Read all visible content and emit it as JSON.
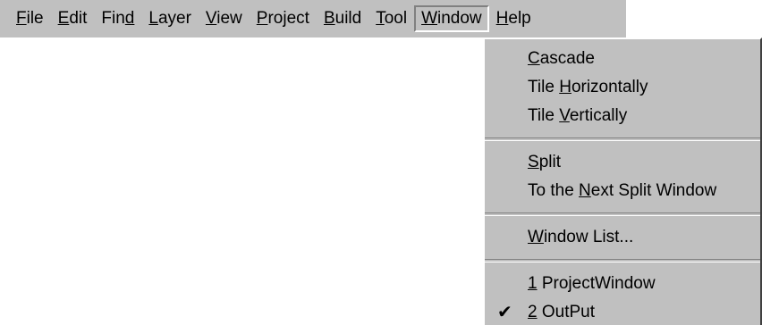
{
  "menubar": {
    "items": [
      {
        "pre": "",
        "ul": "F",
        "post": "ile"
      },
      {
        "pre": "",
        "ul": "E",
        "post": "dit"
      },
      {
        "pre": "Fin",
        "ul": "d",
        "post": ""
      },
      {
        "pre": "",
        "ul": "L",
        "post": "ayer"
      },
      {
        "pre": "",
        "ul": "V",
        "post": "iew"
      },
      {
        "pre": "",
        "ul": "P",
        "post": "roject"
      },
      {
        "pre": "",
        "ul": "B",
        "post": "uild"
      },
      {
        "pre": "",
        "ul": "T",
        "post": "ool"
      },
      {
        "pre": "",
        "ul": "W",
        "post": "indow"
      },
      {
        "pre": "",
        "ul": "H",
        "post": "elp"
      }
    ]
  },
  "window_menu": {
    "cascade": {
      "pre": "",
      "ul": "C",
      "post": "ascade"
    },
    "tile_h": {
      "pre": "Tile ",
      "ul": "H",
      "post": "orizontally"
    },
    "tile_v": {
      "pre": "Tile ",
      "ul": "V",
      "post": "ertically"
    },
    "split": {
      "pre": "",
      "ul": "S",
      "post": "plit"
    },
    "next_split": {
      "pre": "To the ",
      "ul": "N",
      "post": "ext Split Window"
    },
    "window_list": {
      "pre": "",
      "ul": "W",
      "post": "indow List..."
    },
    "win1": {
      "pre": "",
      "ul": "1",
      "post": " ProjectWindow"
    },
    "win2": {
      "pre": "",
      "ul": "2",
      "post": " OutPut",
      "checked": true
    },
    "check_glyph": "✔"
  }
}
